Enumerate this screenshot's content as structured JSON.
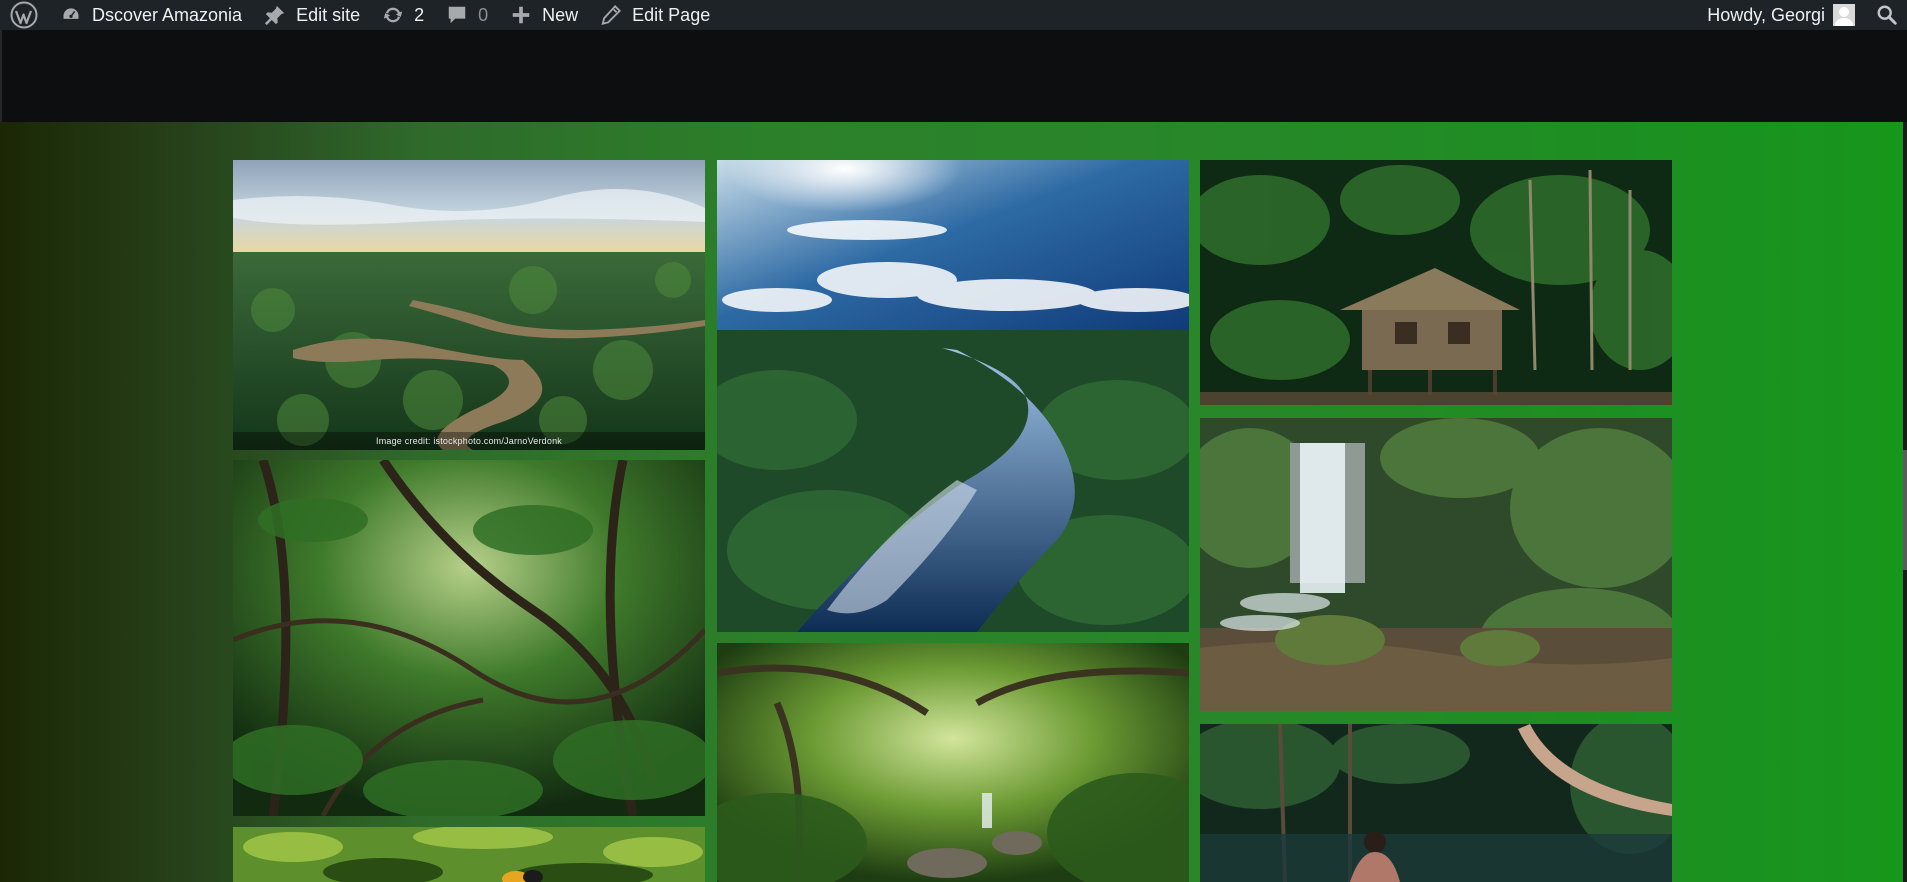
{
  "adminbar": {
    "site_name": "Dscover Amazonia",
    "edit_site": "Edit site",
    "updates_count": "2",
    "comments_count": "0",
    "new_label": "New",
    "edit_page": "Edit Page",
    "howdy": "Howdy, Georgi"
  },
  "gallery": {
    "credit": "Image credit: istockphoto.com/JarnoVerdonk"
  },
  "icons": {
    "wordpress": "wordpress-logo-icon",
    "dashboard": "dashboard-icon",
    "edit_site": "site-editor-pin-icon",
    "updates": "refresh-icon",
    "comments": "speech-bubble-icon",
    "new": "plus-icon",
    "edit_page": "pencil-icon",
    "search": "search-icon"
  },
  "colors": {
    "adminbar": "#1d2327",
    "header": "#0d0e10",
    "gradient_left": "#1b2705",
    "gradient_right": "#17961c"
  }
}
